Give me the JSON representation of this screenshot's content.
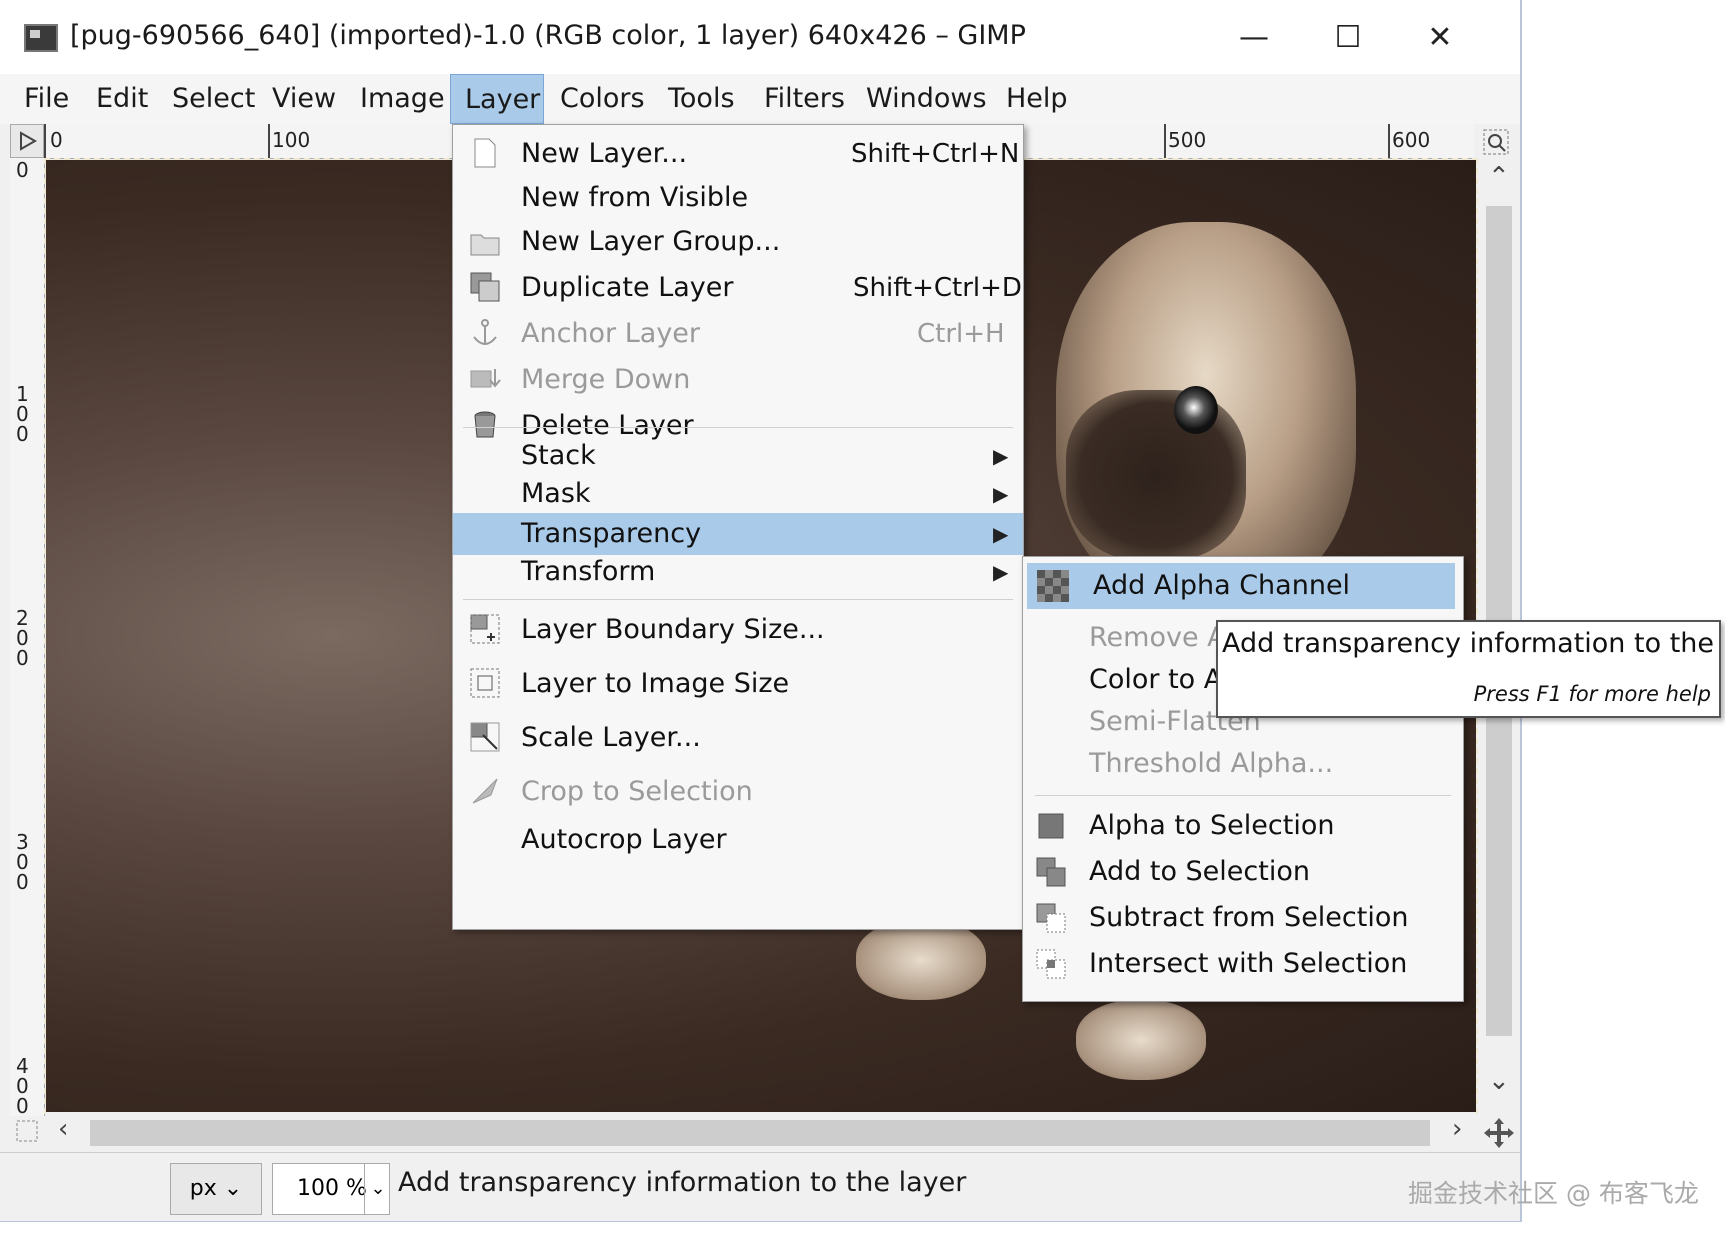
{
  "window": {
    "title": "[pug-690566_640] (imported)-1.0 (RGB color, 1 layer) 640x426 – GIMP",
    "minimize": "—",
    "maximize": "☐",
    "close": "✕"
  },
  "menubar": [
    "File",
    "Edit",
    "Select",
    "View",
    "Image",
    "Layer",
    "Colors",
    "Tools",
    "Filters",
    "Windows",
    "Help"
  ],
  "menubar_active": "Layer",
  "ruler": {
    "top_labels": [
      "0",
      "100",
      "500",
      "600"
    ],
    "left_labels": [
      "0",
      "100",
      "200",
      "300",
      "400"
    ]
  },
  "layer_menu": {
    "items": [
      {
        "label": "New Layer...",
        "shortcut": "Shift+Ctrl+N",
        "icon": "new-layer-icon",
        "enabled": true
      },
      {
        "label": "New from Visible",
        "shortcut": "",
        "icon": "",
        "enabled": true
      },
      {
        "label": "New Layer Group...",
        "shortcut": "",
        "icon": "folder-icon",
        "enabled": true
      },
      {
        "label": "Duplicate Layer",
        "shortcut": "Shift+Ctrl+D",
        "icon": "duplicate-icon",
        "enabled": true
      },
      {
        "label": "Anchor Layer",
        "shortcut": "Ctrl+H",
        "icon": "anchor-icon",
        "enabled": false
      },
      {
        "label": "Merge Down",
        "shortcut": "",
        "icon": "merge-down-icon",
        "enabled": false
      },
      {
        "label": "Delete Layer",
        "shortcut": "",
        "icon": "delete-icon",
        "enabled": true
      },
      {
        "label": "Stack",
        "submenu": true,
        "enabled": true
      },
      {
        "label": "Mask",
        "submenu": true,
        "enabled": true
      },
      {
        "label": "Transparency",
        "submenu": true,
        "enabled": true,
        "highlighted": true
      },
      {
        "label": "Transform",
        "submenu": true,
        "enabled": true
      },
      {
        "label": "Layer Boundary Size...",
        "shortcut": "",
        "icon": "boundary-size-icon",
        "enabled": true
      },
      {
        "label": "Layer to Image Size",
        "shortcut": "",
        "icon": "layer-to-image-icon",
        "enabled": true
      },
      {
        "label": "Scale Layer...",
        "shortcut": "",
        "icon": "scale-icon",
        "enabled": true
      },
      {
        "label": "Crop to Selection",
        "shortcut": "",
        "icon": "crop-icon",
        "enabled": false
      },
      {
        "label": "Autocrop Layer",
        "shortcut": "",
        "icon": "",
        "enabled": true
      }
    ]
  },
  "transparency_menu": {
    "items": [
      {
        "label": "Add Alpha Channel",
        "icon": "checker-icon",
        "enabled": true,
        "highlighted": true
      },
      {
        "label": "Remove Al",
        "enabled": false
      },
      {
        "label": "Color to Al",
        "enabled": true
      },
      {
        "label": "Semi-Flatten",
        "enabled": false
      },
      {
        "label": "Threshold Alpha...",
        "enabled": false
      },
      {
        "label": "Alpha to Selection",
        "icon": "alpha-selection-icon",
        "enabled": true
      },
      {
        "label": "Add to Selection",
        "icon": "add-selection-icon",
        "enabled": true
      },
      {
        "label": "Subtract from Selection",
        "icon": "subtract-selection-icon",
        "enabled": true
      },
      {
        "label": "Intersect with Selection",
        "icon": "intersect-selection-icon",
        "enabled": true
      }
    ]
  },
  "tooltip": {
    "text": "Add transparency information to the layer",
    "help": "Press F1 for more help"
  },
  "statusbar": {
    "unit": "px",
    "zoom": "100 %",
    "message": "Add transparency information to the layer"
  },
  "watermark": "掘金技术社区 @ 布客飞龙",
  "colors": {
    "highlight": "#a9cbe9",
    "menu_bg": "#f7f7f7",
    "disabled_text": "#9a9a9a"
  }
}
